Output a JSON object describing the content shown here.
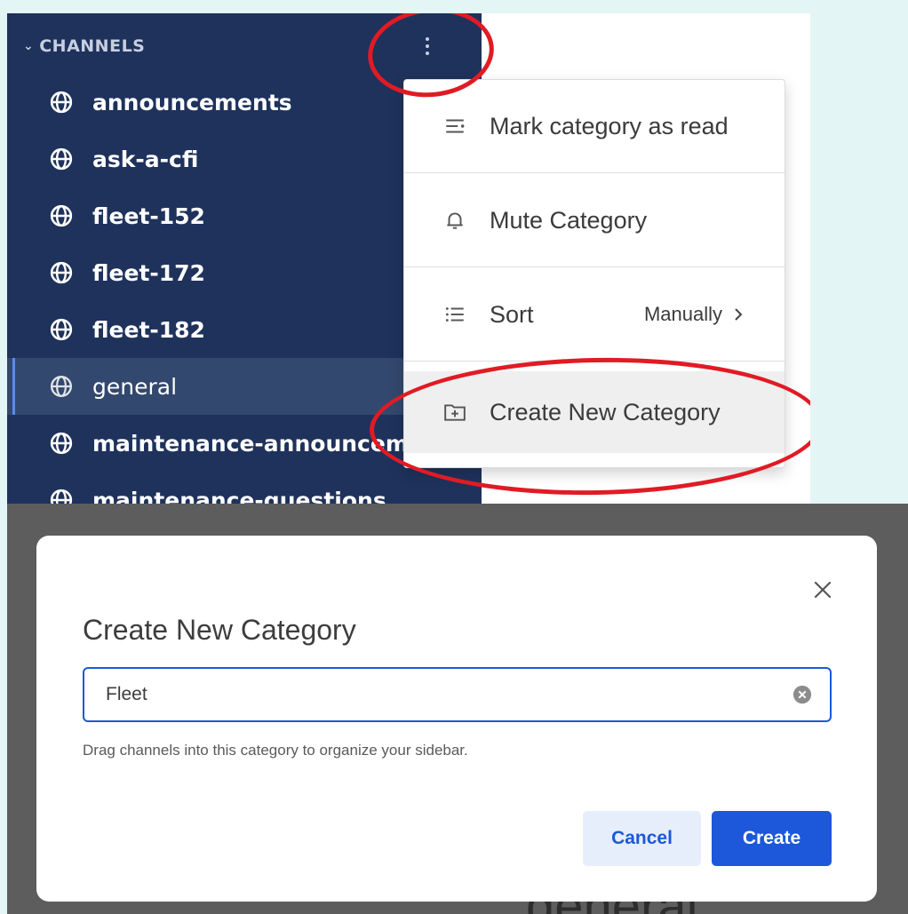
{
  "sidebar": {
    "header": "CHANNELS",
    "channels": [
      {
        "name": "announcements"
      },
      {
        "name": "ask-a-cfi"
      },
      {
        "name": "fleet-152"
      },
      {
        "name": "fleet-172"
      },
      {
        "name": "fleet-182"
      },
      {
        "name": "general",
        "active": true
      },
      {
        "name": "maintenance-announcem"
      },
      {
        "name": "maintenance-questions"
      }
    ]
  },
  "menu": {
    "items": [
      {
        "label": "Mark category as read",
        "icon": "mark-read-icon"
      },
      {
        "label": "Mute Category",
        "icon": "bell-icon"
      },
      {
        "label": "Sort",
        "hint": "Manually",
        "icon": "list-icon"
      },
      {
        "label": "Create New Category",
        "icon": "folder-plus-icon"
      }
    ]
  },
  "modal": {
    "title": "Create New Category",
    "input_value": "Fleet",
    "help": "Drag channels into this category to organize your sidebar.",
    "cancel_label": "Cancel",
    "create_label": "Create"
  },
  "background_text": "general",
  "colors": {
    "sidebar_bg": "#1e325c",
    "accent": "#1c58d9",
    "annotation": "#e01b24",
    "overlay": "#5d5d5d",
    "page_bg": "#e3f5f4"
  }
}
